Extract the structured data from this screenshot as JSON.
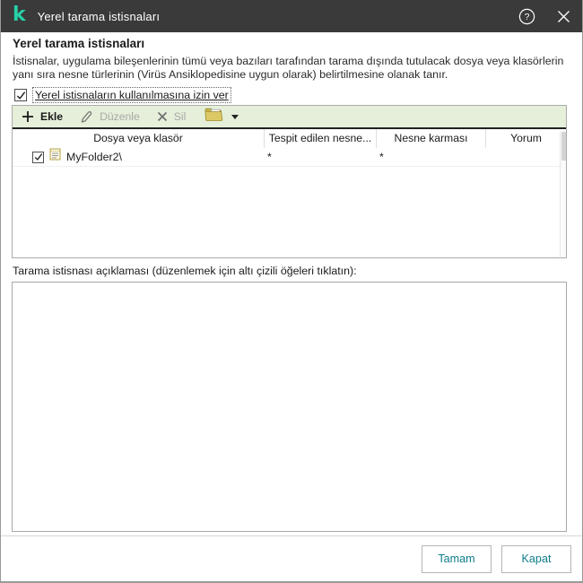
{
  "titlebar": {
    "title": "Yerel tarama istisnaları"
  },
  "header": {
    "title": "Yerel tarama istisnaları",
    "description": "İstisnalar, uygulama bileşenlerinin tümü veya bazıları tarafından tarama dışında tutulacak dosya veya klasörlerin yanı sıra nesne türlerinin (Virüs Ansiklopedisine uygun olarak) belirtilmesine olanak tanır."
  },
  "allow_checkbox": {
    "label": "Yerel istisnaların kullanılmasına izin ver",
    "checked": true
  },
  "toolbar": {
    "add_label": "Ekle",
    "edit_label": "Düzenle",
    "delete_label": "Sil"
  },
  "table": {
    "columns": [
      "Dosya veya klasör",
      "Tespit edilen nesne...",
      "Nesne karması",
      "Yorum"
    ],
    "rows": [
      {
        "checked": true,
        "file_or_folder": "MyFolder2\\",
        "detected_object": "*",
        "object_hash": "*",
        "comment": ""
      }
    ]
  },
  "exclusion_description_label": "Tarama istisnası açıklaması (düzenlemek için altı çizili öğeleri tıklatın):",
  "exclusion_description_text": "",
  "footer": {
    "ok_label": "Tamam",
    "close_label": "Kapat"
  },
  "colors": {
    "titlebar_bg": "#3a3a3a",
    "logo_teal": "#26d0a8",
    "toolbar_bg": "#e5efd9",
    "accent_teal": "#0e7d8a",
    "folder_icon": "#d9c35c"
  }
}
